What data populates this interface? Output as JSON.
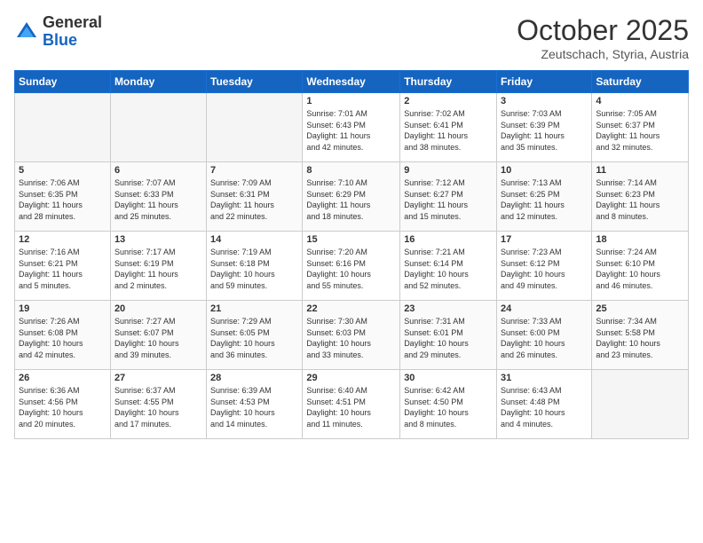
{
  "header": {
    "logo_general": "General",
    "logo_blue": "Blue",
    "month": "October 2025",
    "location": "Zeutschach, Styria, Austria"
  },
  "days_of_week": [
    "Sunday",
    "Monday",
    "Tuesday",
    "Wednesday",
    "Thursday",
    "Friday",
    "Saturday"
  ],
  "weeks": [
    [
      {
        "day": "",
        "empty": true
      },
      {
        "day": "",
        "empty": true
      },
      {
        "day": "",
        "empty": true
      },
      {
        "day": "1",
        "lines": [
          "Sunrise: 7:01 AM",
          "Sunset: 6:43 PM",
          "Daylight: 11 hours",
          "and 42 minutes."
        ]
      },
      {
        "day": "2",
        "lines": [
          "Sunrise: 7:02 AM",
          "Sunset: 6:41 PM",
          "Daylight: 11 hours",
          "and 38 minutes."
        ]
      },
      {
        "day": "3",
        "lines": [
          "Sunrise: 7:03 AM",
          "Sunset: 6:39 PM",
          "Daylight: 11 hours",
          "and 35 minutes."
        ]
      },
      {
        "day": "4",
        "lines": [
          "Sunrise: 7:05 AM",
          "Sunset: 6:37 PM",
          "Daylight: 11 hours",
          "and 32 minutes."
        ]
      }
    ],
    [
      {
        "day": "5",
        "lines": [
          "Sunrise: 7:06 AM",
          "Sunset: 6:35 PM",
          "Daylight: 11 hours",
          "and 28 minutes."
        ]
      },
      {
        "day": "6",
        "lines": [
          "Sunrise: 7:07 AM",
          "Sunset: 6:33 PM",
          "Daylight: 11 hours",
          "and 25 minutes."
        ]
      },
      {
        "day": "7",
        "lines": [
          "Sunrise: 7:09 AM",
          "Sunset: 6:31 PM",
          "Daylight: 11 hours",
          "and 22 minutes."
        ]
      },
      {
        "day": "8",
        "lines": [
          "Sunrise: 7:10 AM",
          "Sunset: 6:29 PM",
          "Daylight: 11 hours",
          "and 18 minutes."
        ]
      },
      {
        "day": "9",
        "lines": [
          "Sunrise: 7:12 AM",
          "Sunset: 6:27 PM",
          "Daylight: 11 hours",
          "and 15 minutes."
        ]
      },
      {
        "day": "10",
        "lines": [
          "Sunrise: 7:13 AM",
          "Sunset: 6:25 PM",
          "Daylight: 11 hours",
          "and 12 minutes."
        ]
      },
      {
        "day": "11",
        "lines": [
          "Sunrise: 7:14 AM",
          "Sunset: 6:23 PM",
          "Daylight: 11 hours",
          "and 8 minutes."
        ]
      }
    ],
    [
      {
        "day": "12",
        "lines": [
          "Sunrise: 7:16 AM",
          "Sunset: 6:21 PM",
          "Daylight: 11 hours",
          "and 5 minutes."
        ]
      },
      {
        "day": "13",
        "lines": [
          "Sunrise: 7:17 AM",
          "Sunset: 6:19 PM",
          "Daylight: 11 hours",
          "and 2 minutes."
        ]
      },
      {
        "day": "14",
        "lines": [
          "Sunrise: 7:19 AM",
          "Sunset: 6:18 PM",
          "Daylight: 10 hours",
          "and 59 minutes."
        ]
      },
      {
        "day": "15",
        "lines": [
          "Sunrise: 7:20 AM",
          "Sunset: 6:16 PM",
          "Daylight: 10 hours",
          "and 55 minutes."
        ]
      },
      {
        "day": "16",
        "lines": [
          "Sunrise: 7:21 AM",
          "Sunset: 6:14 PM",
          "Daylight: 10 hours",
          "and 52 minutes."
        ]
      },
      {
        "day": "17",
        "lines": [
          "Sunrise: 7:23 AM",
          "Sunset: 6:12 PM",
          "Daylight: 10 hours",
          "and 49 minutes."
        ]
      },
      {
        "day": "18",
        "lines": [
          "Sunrise: 7:24 AM",
          "Sunset: 6:10 PM",
          "Daylight: 10 hours",
          "and 46 minutes."
        ]
      }
    ],
    [
      {
        "day": "19",
        "lines": [
          "Sunrise: 7:26 AM",
          "Sunset: 6:08 PM",
          "Daylight: 10 hours",
          "and 42 minutes."
        ]
      },
      {
        "day": "20",
        "lines": [
          "Sunrise: 7:27 AM",
          "Sunset: 6:07 PM",
          "Daylight: 10 hours",
          "and 39 minutes."
        ]
      },
      {
        "day": "21",
        "lines": [
          "Sunrise: 7:29 AM",
          "Sunset: 6:05 PM",
          "Daylight: 10 hours",
          "and 36 minutes."
        ]
      },
      {
        "day": "22",
        "lines": [
          "Sunrise: 7:30 AM",
          "Sunset: 6:03 PM",
          "Daylight: 10 hours",
          "and 33 minutes."
        ]
      },
      {
        "day": "23",
        "lines": [
          "Sunrise: 7:31 AM",
          "Sunset: 6:01 PM",
          "Daylight: 10 hours",
          "and 29 minutes."
        ]
      },
      {
        "day": "24",
        "lines": [
          "Sunrise: 7:33 AM",
          "Sunset: 6:00 PM",
          "Daylight: 10 hours",
          "and 26 minutes."
        ]
      },
      {
        "day": "25",
        "lines": [
          "Sunrise: 7:34 AM",
          "Sunset: 5:58 PM",
          "Daylight: 10 hours",
          "and 23 minutes."
        ]
      }
    ],
    [
      {
        "day": "26",
        "lines": [
          "Sunrise: 6:36 AM",
          "Sunset: 4:56 PM",
          "Daylight: 10 hours",
          "and 20 minutes."
        ]
      },
      {
        "day": "27",
        "lines": [
          "Sunrise: 6:37 AM",
          "Sunset: 4:55 PM",
          "Daylight: 10 hours",
          "and 17 minutes."
        ]
      },
      {
        "day": "28",
        "lines": [
          "Sunrise: 6:39 AM",
          "Sunset: 4:53 PM",
          "Daylight: 10 hours",
          "and 14 minutes."
        ]
      },
      {
        "day": "29",
        "lines": [
          "Sunrise: 6:40 AM",
          "Sunset: 4:51 PM",
          "Daylight: 10 hours",
          "and 11 minutes."
        ]
      },
      {
        "day": "30",
        "lines": [
          "Sunrise: 6:42 AM",
          "Sunset: 4:50 PM",
          "Daylight: 10 hours",
          "and 8 minutes."
        ]
      },
      {
        "day": "31",
        "lines": [
          "Sunrise: 6:43 AM",
          "Sunset: 4:48 PM",
          "Daylight: 10 hours",
          "and 4 minutes."
        ]
      },
      {
        "day": "",
        "empty": true
      }
    ]
  ]
}
